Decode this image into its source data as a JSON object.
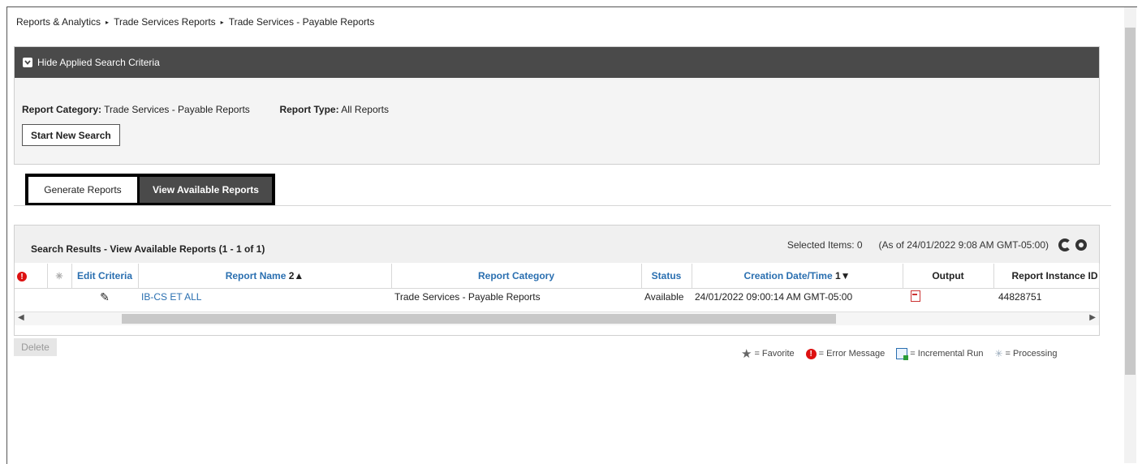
{
  "breadcrumb": {
    "items": [
      "Reports & Analytics",
      "Trade Services Reports",
      "Trade Services - Payable Reports"
    ],
    "separator": "▸"
  },
  "criteria": {
    "toggle_label": "Hide Applied Search Criteria",
    "category_label": "Report Category:",
    "category_value": "Trade Services - Payable Reports",
    "type_label": "Report Type:",
    "type_value": "All Reports",
    "start_new_search": "Start New Search"
  },
  "tabs": [
    {
      "label": "Generate Reports",
      "active": false
    },
    {
      "label": "View Available Reports",
      "active": true
    }
  ],
  "results": {
    "title": "Search Results - View Available Reports (1 - 1 of 1)",
    "selected_items": "Selected Items: 0",
    "as_of": "(As of 24/01/2022 9:08 AM GMT-05:00)",
    "columns": {
      "edit_criteria": "Edit Criteria",
      "report_name": "Report Name",
      "report_name_sort": "2▲",
      "report_category": "Report Category",
      "status": "Status",
      "creation": "Creation Date/Time",
      "creation_sort": "1▼",
      "output": "Output",
      "report_instance": "Report Instance ID"
    },
    "rows": [
      {
        "report_name": "IB-CS ET ALL",
        "report_category": "Trade Services - Payable Reports",
        "status": "Available",
        "creation": "24/01/2022 09:00:14 AM GMT-05:00",
        "report_instance": "44828751"
      }
    ]
  },
  "delete_label": "Delete",
  "legend": {
    "favorite": "= Favorite",
    "error": "= Error Message",
    "incremental": "= Incremental Run",
    "processing": "= Processing"
  },
  "colors": {
    "header_dark": "#4a4a4a",
    "link_blue": "#2a6fb0",
    "error_red": "#dd1111"
  }
}
